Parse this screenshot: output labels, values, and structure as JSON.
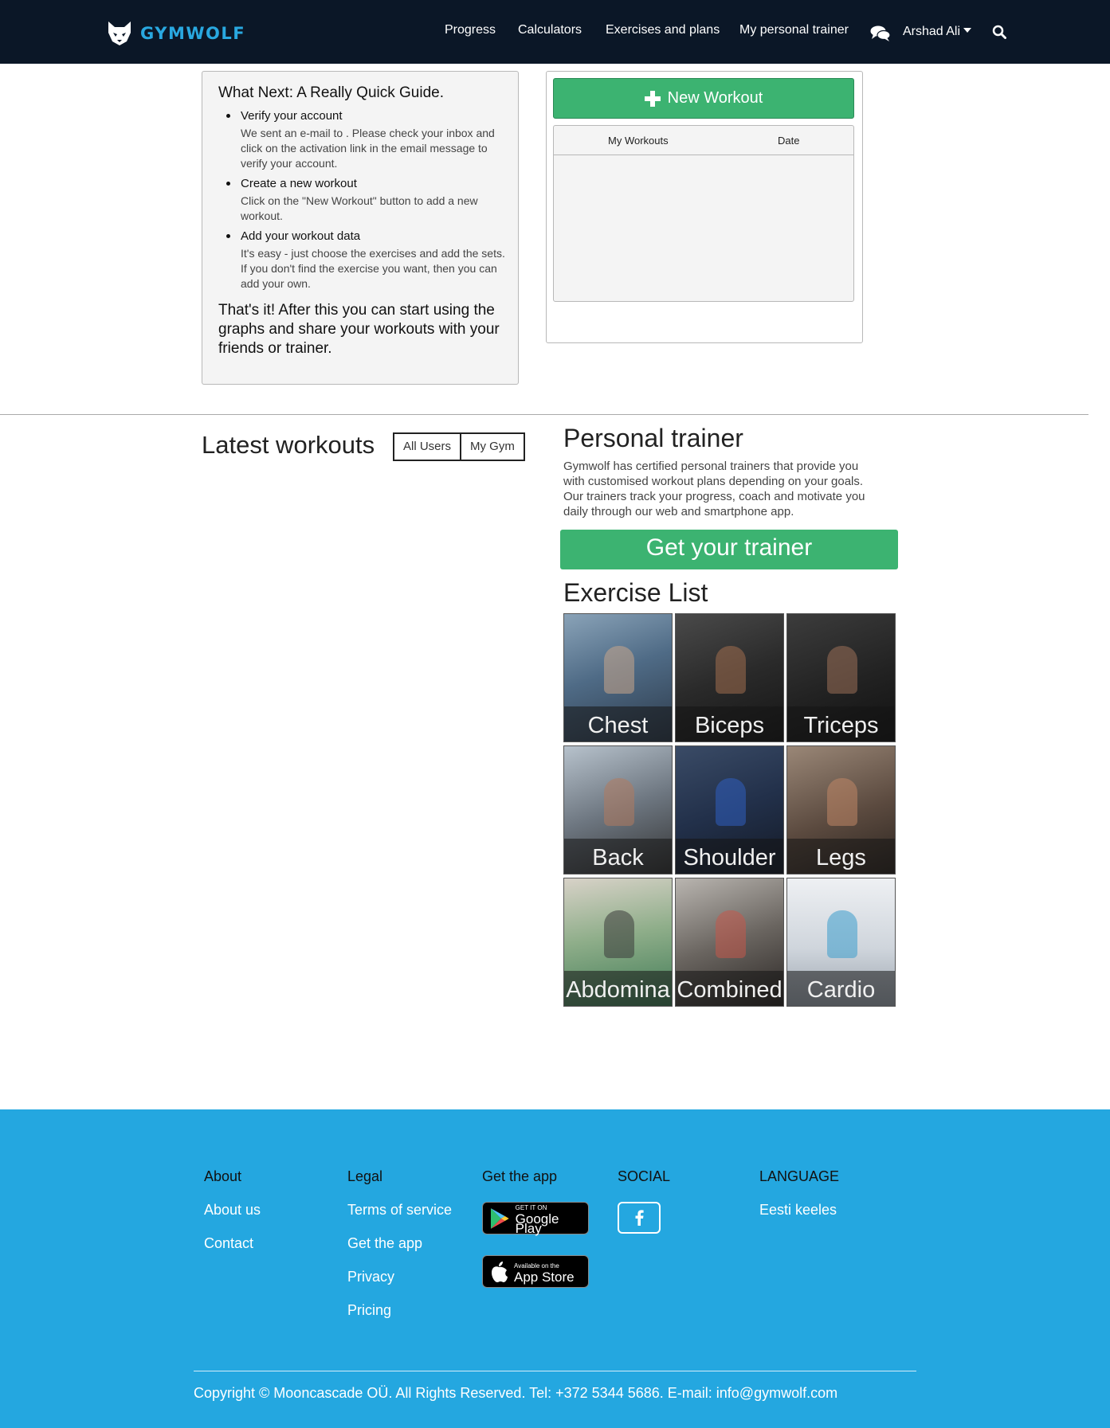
{
  "brand": {
    "name": "GYMWOLF",
    "icon": "wolf-logo-icon",
    "color": "#29a8e0"
  },
  "nav": {
    "links": [
      "Progress",
      "Calculators",
      "Exercises and plans",
      "My personal trainer"
    ],
    "user": "Arshad Ali",
    "icons": [
      "chat-icon",
      "search-icon",
      "caret-down-icon"
    ]
  },
  "guide": {
    "title": "What Next: A Really Quick Guide.",
    "steps": [
      {
        "title": "Verify your account",
        "text": "We sent an e-mail to . Please check your inbox and click on the activation link in the email message to verify your account."
      },
      {
        "title": "Create a new workout",
        "text": "Click on the \"New Workout\" button to add a new workout."
      },
      {
        "title": "Add your workout data",
        "text": "It's easy - just choose the exercises and add the sets. If you don't find the exercise you want, then you can add your own."
      }
    ],
    "outro": "That's it! After this you can start using the graphs and share your workouts with your friends or trainer."
  },
  "workouts": {
    "new_button": "New Workout",
    "columns": [
      "My Workouts",
      "Date"
    ],
    "accent": "#3cb371"
  },
  "latest": {
    "title": "Latest workouts",
    "filters": [
      "All Users",
      "My Gym"
    ]
  },
  "trainer": {
    "title": "Personal trainer",
    "text": "Gymwolf has certified personal trainers that provide you with customised workout plans depending on your goals. Our trainers track your progress, coach and motivate you daily through our web and smartphone app.",
    "button": "Get your trainer"
  },
  "exercises": {
    "title": "Exercise List",
    "items": [
      "Chest",
      "Biceps",
      "Triceps",
      "Back",
      "Shoulder",
      "Legs",
      "Abdomina",
      "Combined",
      "Cardio"
    ]
  },
  "footer": {
    "about": {
      "heading": "About",
      "links": [
        "About us",
        "Contact"
      ]
    },
    "legal": {
      "heading": "Legal",
      "links": [
        "Terms of service",
        "Get the app",
        "Privacy",
        "Pricing"
      ]
    },
    "app": {
      "heading": "Get the app",
      "google": {
        "small": "GET IT ON",
        "big": "Google Play"
      },
      "apple": {
        "small": "Available on the",
        "big": "App Store"
      }
    },
    "social": {
      "heading": "SOCIAL",
      "icon": "facebook-icon"
    },
    "language": {
      "heading": "LANGUAGE",
      "links": [
        "Eesti keeles"
      ]
    },
    "copyright": "Copyright © Mooncascade OÜ. All Rights Reserved. Tel: +372 5344 5686. E-mail: info@gymwolf.com",
    "color": "#24a7e0"
  }
}
